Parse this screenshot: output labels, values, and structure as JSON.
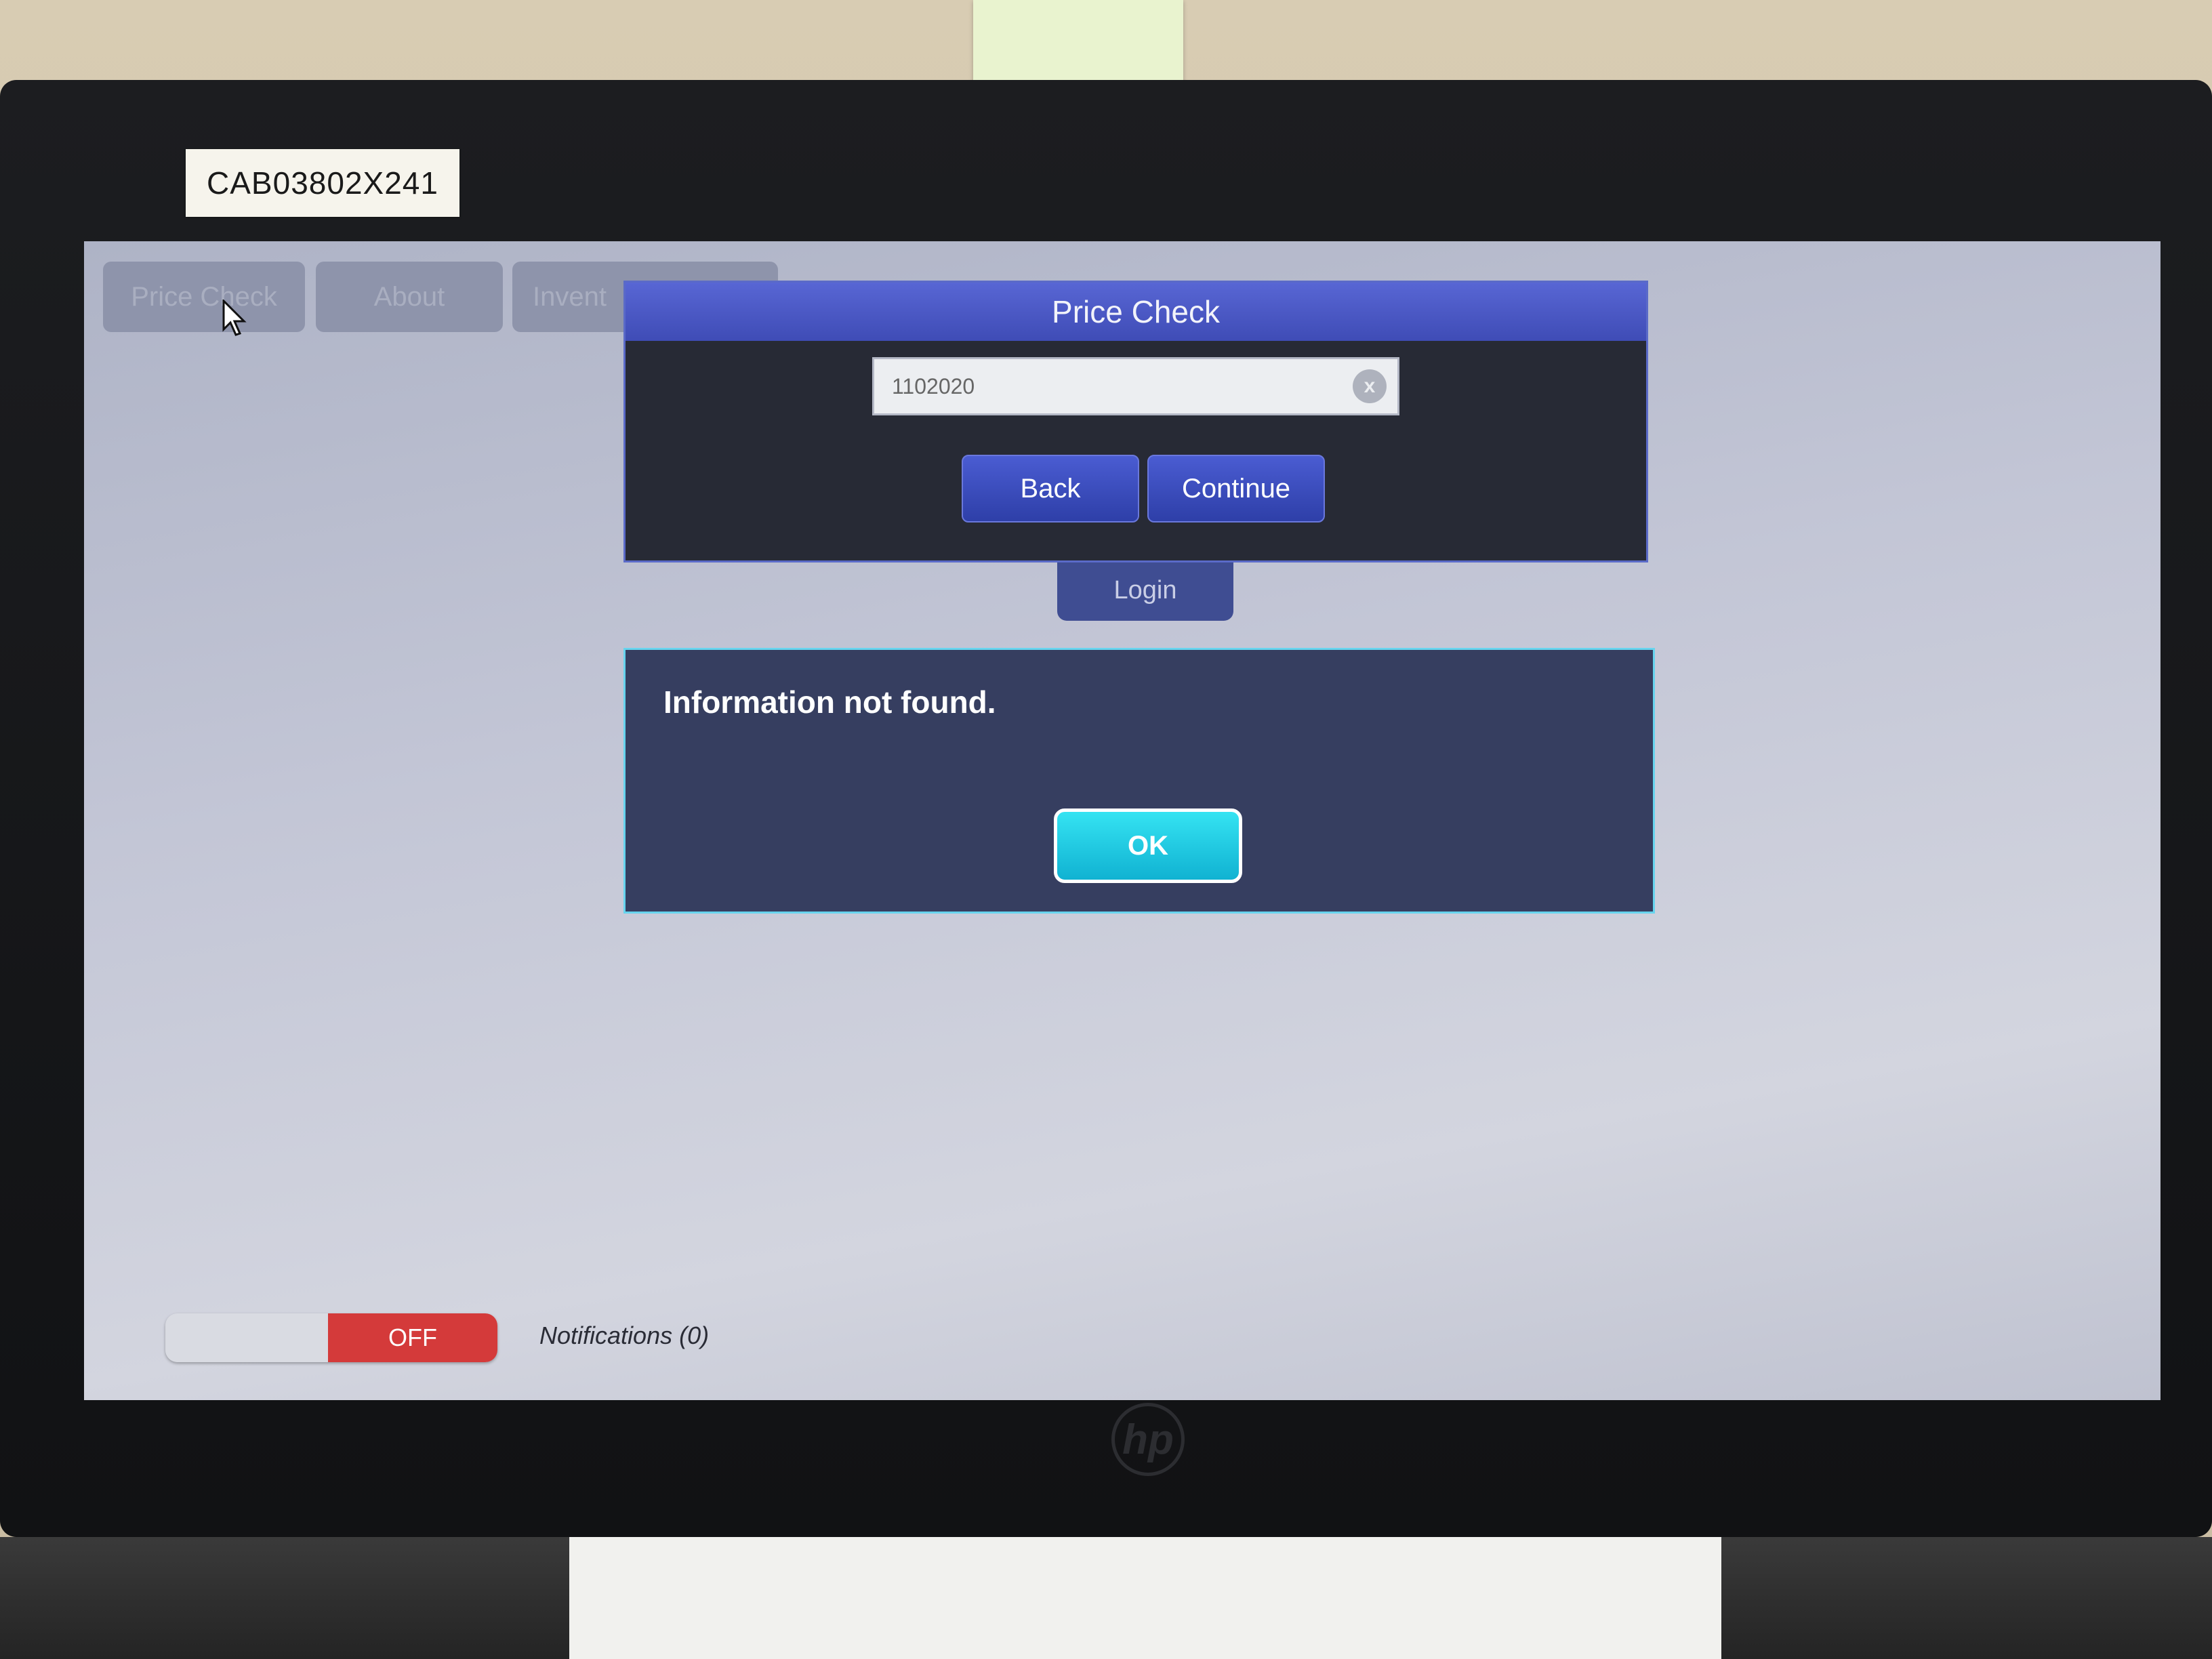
{
  "asset_tag": "CAB03802X241",
  "nav_tabs": [
    {
      "label": "Price Check"
    },
    {
      "label": "About"
    },
    {
      "label": "Invent"
    }
  ],
  "login": {
    "label": "Login"
  },
  "price_check_dialog": {
    "title": "Price Check",
    "search_value": "1102020",
    "clear_icon": "x",
    "back_label": "Back",
    "continue_label": "Continue"
  },
  "alert": {
    "message": "Information not found.",
    "ok_label": "OK"
  },
  "status_bar": {
    "toggle_label": "OFF",
    "notifications": "Notifications (0)"
  },
  "brand_logo": "hp",
  "colors": {
    "dialog_title": "#4b58c8",
    "button_blue": "#3446b8",
    "ok_cyan": "#1fc6e0",
    "toggle_red": "#d43a3a"
  }
}
